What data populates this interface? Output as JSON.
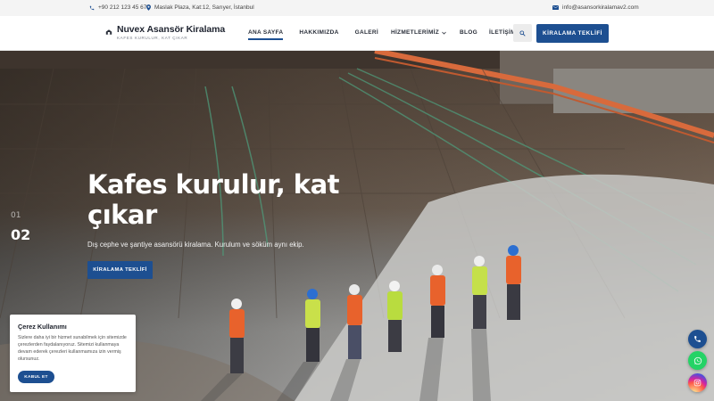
{
  "topbar": {
    "phone": "+90 212 123 45 67",
    "address": "Maslak Plaza, Kat:12, Sarıyer, İstanbul",
    "email": "info@asansorkiralamav2.com"
  },
  "brand": {
    "name": "Nuvex Asansör Kiralama",
    "tagline": "KAFES KURULUR, KAT ÇIKAR"
  },
  "nav": {
    "items": [
      {
        "label": "ANA SAYFA",
        "active": true
      },
      {
        "label": "HAKKIMIZDA",
        "active": false
      },
      {
        "label": "GALERİ",
        "active": false
      },
      {
        "label": "HİZMETLERİMİZ",
        "active": false,
        "dropdown": true
      },
      {
        "label": "BLOG",
        "active": false
      },
      {
        "label": "İLETİŞİM",
        "active": false
      }
    ],
    "cta_label": "KİRALAMA TEKLİFİ"
  },
  "hero": {
    "slide_prev": "01",
    "slide_current": "02",
    "title": "Kafes kurulur, kat çıkar",
    "subtitle": "Dış cephe ve şantiye asansörü kiralama. Kurulum ve söküm aynı ekip.",
    "button_label": "KİRALAMA TEKLİFİ"
  },
  "cookie": {
    "title": "Çerez Kullanımı",
    "text": "Sizlere daha iyi bir hizmet sunabilmek için sitemizde çerezlerden faydalanıyoruz. Sitemizi kullanmaya devam ederek çerezleri kullanmamıza izin vermiş olursunuz.",
    "accept_label": "KABUL ET"
  },
  "colors": {
    "brand": "#1d4f91",
    "whatsapp": "#25d366"
  },
  "icons": {
    "phone": "phone-icon",
    "address": "map-pin-icon",
    "email": "envelope-icon",
    "search": "search-icon",
    "float_phone": "phone-icon",
    "float_whatsapp": "whatsapp-icon",
    "float_instagram": "instagram-icon"
  }
}
